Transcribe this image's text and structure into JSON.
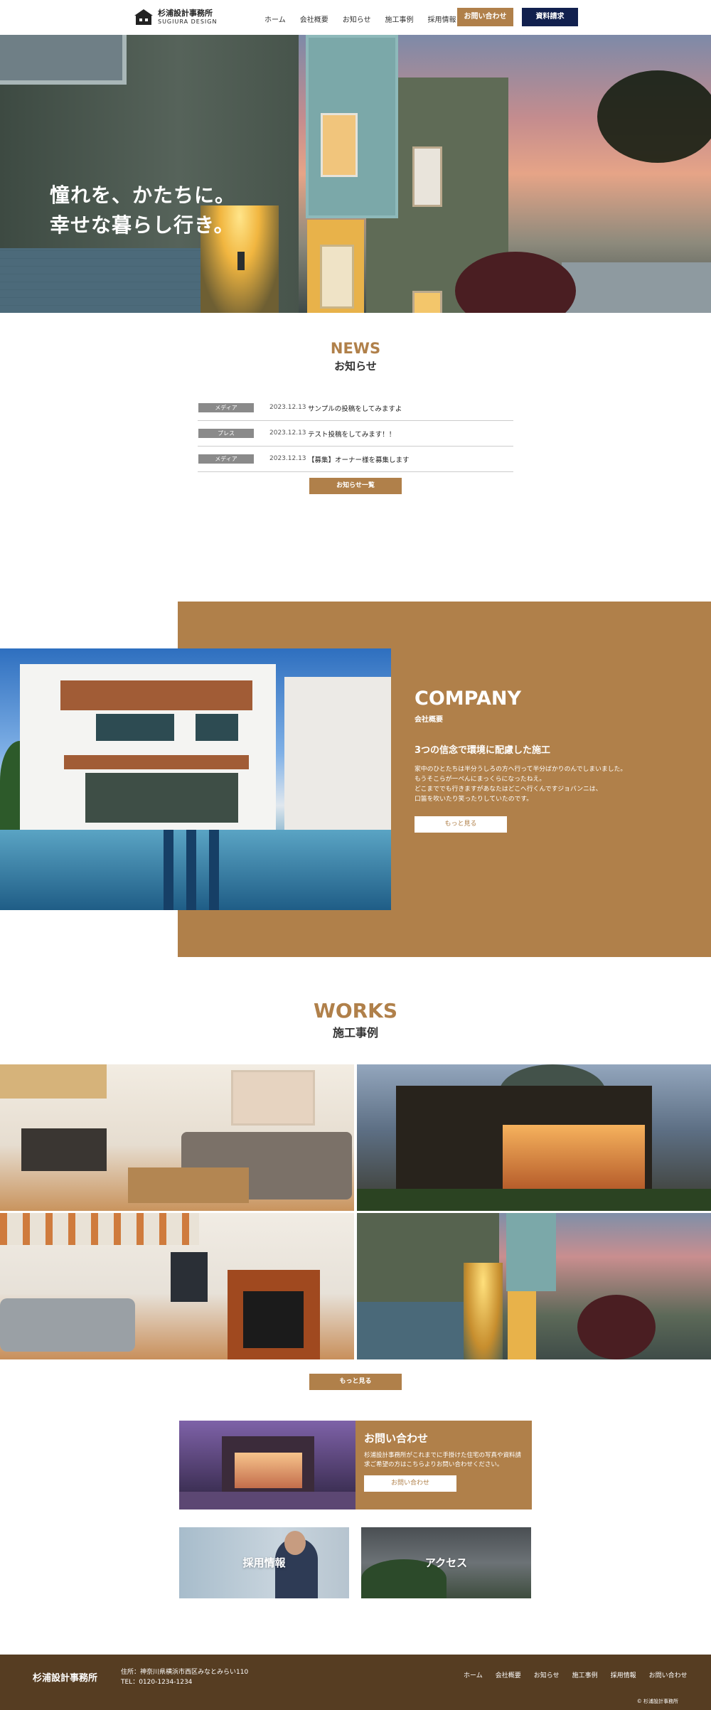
{
  "header": {
    "logo_name": "杉浦設計事務所",
    "logo_en": "SUGIURA DESIGN",
    "nav": [
      "ホーム",
      "会社概要",
      "お知らせ",
      "施工事例",
      "採用情報"
    ],
    "contact_button": "お問い合わせ",
    "docs_button": "資料請求"
  },
  "hero": {
    "line1": "憧れを、かたちに。",
    "line2": "幸せな暮らし行き。"
  },
  "news": {
    "title_en": "NEWS",
    "title_ja": "お知らせ",
    "items": [
      {
        "category": "メディア",
        "date": "2023.12.13",
        "title": "サンプルの投稿をしてみますよ"
      },
      {
        "category": "プレス",
        "date": "2023.12.13",
        "title": "テスト投稿をしてみます！！"
      },
      {
        "category": "メディア",
        "date": "2023.12.13",
        "title": "【募集】オーナー様を募集します"
      }
    ],
    "more_button": "お知らせ一覧"
  },
  "company": {
    "title_en": "COMPANY",
    "title_ja": "会社概要",
    "heading": "3つの信念で環境に配慮した施工",
    "body": [
      "家中のひとたちは半分うしろの方へ行って半分ばかりのんでしまいました。",
      "もうそこらが一ぺんにまっくらになったねえ。",
      "どこまででも行きますがあなたはどこへ行くんですジョバンニは、",
      "口笛を吹いたり笑ったりしていたのです。"
    ],
    "more_button": "もっと見る"
  },
  "works": {
    "title_en": "WORKS",
    "title_ja": "施工事例",
    "more_button": "もっと見る"
  },
  "contact": {
    "title": "お問い合わせ",
    "body": "杉浦設計事務所がこれまでに手掛けた住宅の写真や資料請求ご希望の方はこちらよりお問い合わせください。",
    "button": "お問い合わせ"
  },
  "cards": {
    "recruit": "採用情報",
    "access": "アクセス"
  },
  "footer": {
    "name": "杉浦設計事務所",
    "address": "住所：神奈川県横浜市西区みなとみらい110",
    "tel": "TEL：0120-1234-1234",
    "nav": [
      "ホーム",
      "会社概要",
      "お知らせ",
      "施工事例",
      "採用情報",
      "お問い合わせ"
    ],
    "copyright": "© 杉浦設計事務所"
  },
  "colors": {
    "accent": "#b0804a",
    "navy": "#11204e",
    "footer": "#563d22"
  }
}
